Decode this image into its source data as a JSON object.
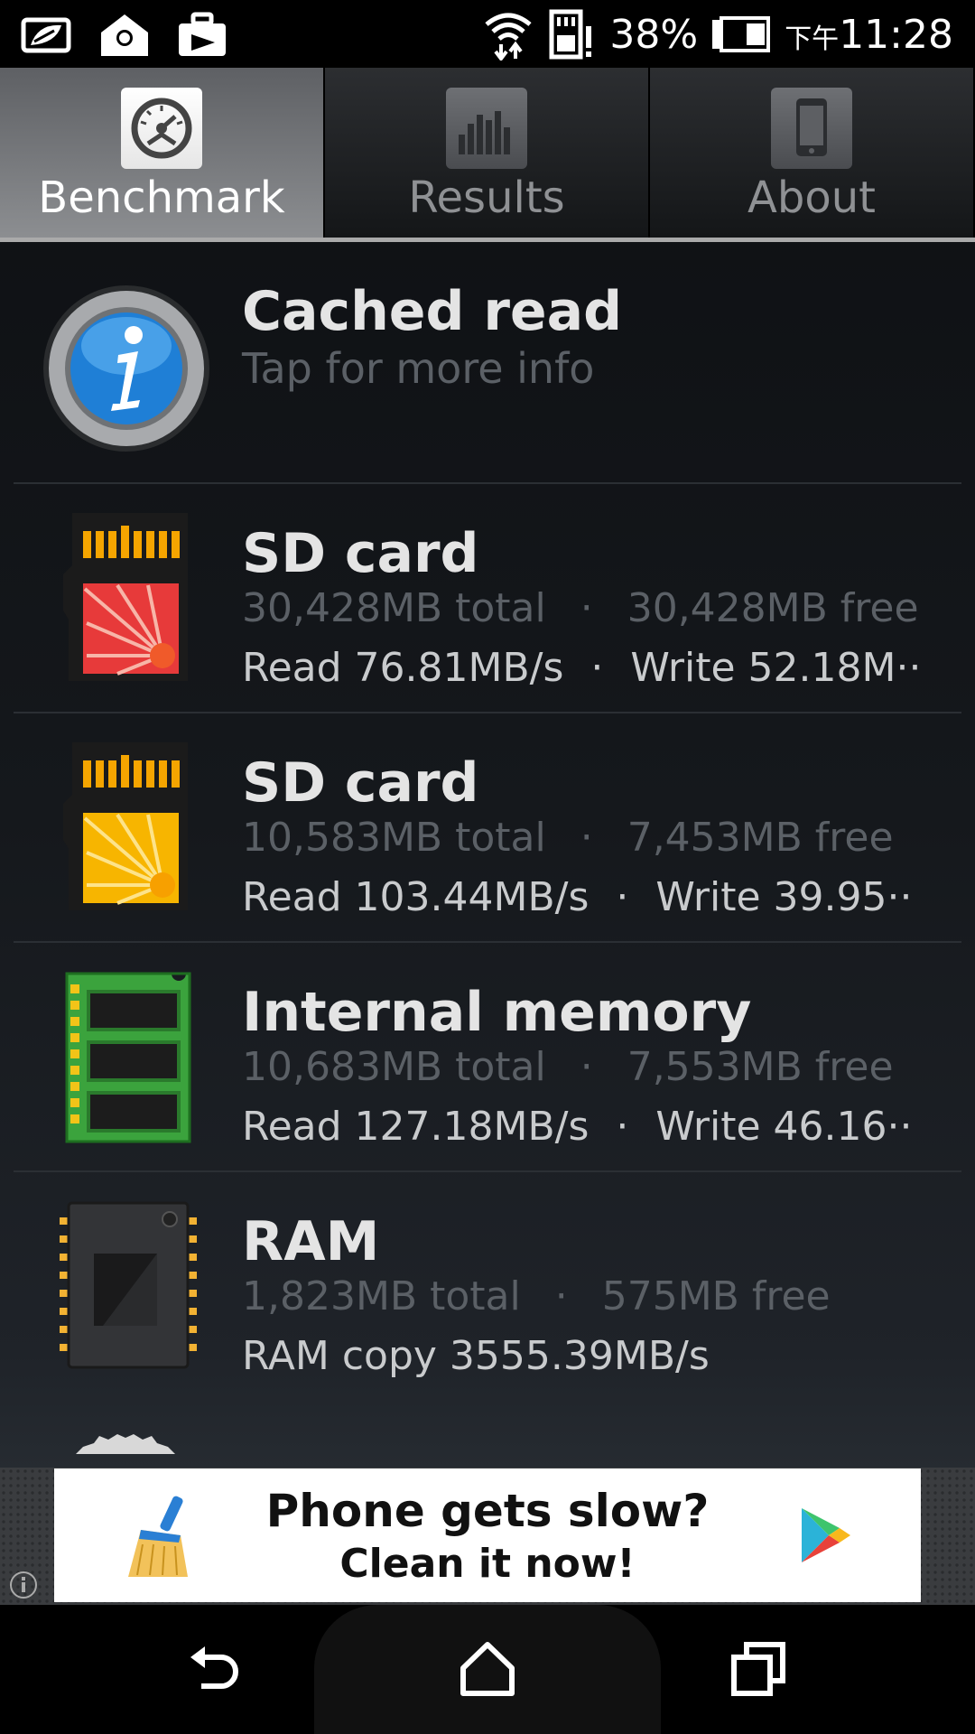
{
  "status_bar": {
    "battery_percent": "38%",
    "time_prefix": "下午",
    "time": "11:28",
    "left_icons": [
      "leaf-icon",
      "location-icon",
      "briefcase-icon"
    ],
    "right_icons": [
      "wifi-icon",
      "sd-alert-icon",
      "battery-icon"
    ]
  },
  "tabs": [
    {
      "label": "Benchmark",
      "icon": "gauge-icon",
      "active": true
    },
    {
      "label": "Results",
      "icon": "bars-icon",
      "active": false
    },
    {
      "label": "About",
      "icon": "phone-icon",
      "active": false
    }
  ],
  "list": {
    "info_row": {
      "title": "Cached read",
      "subtitle": "Tap for more info",
      "icon": "info-icon"
    },
    "items": [
      {
        "title": "SD card",
        "total": "30,428MB total",
        "free": "30,428MB free",
        "read": "Read 76.81MB/s",
        "write": "Write 52.18M··",
        "icon": "sd-card-red-icon",
        "accent": "#e53b3b"
      },
      {
        "title": "SD card",
        "total": "10,583MB total",
        "free": "7,453MB free",
        "read": "Read 103.44MB/s",
        "write": "Write 39.95··",
        "icon": "sd-card-yellow-icon",
        "accent": "#f5b800"
      },
      {
        "title": "Internal memory",
        "total": "10,683MB total",
        "free": "7,553MB free",
        "read": "Read 127.18MB/s",
        "write": "Write 46.16··",
        "icon": "memory-chip-icon",
        "accent": "#3fa341"
      },
      {
        "title": "RAM",
        "total": "1,823MB total",
        "free": "575MB free",
        "read": "RAM copy 3555.39MB/s",
        "write": "",
        "icon": "ram-chip-icon",
        "accent": "#f2b233"
      }
    ],
    "separator": "·"
  },
  "ad": {
    "line1": "Phone gets slow?",
    "line2": "Clean it now!",
    "icons": [
      "broom-icon",
      "play-store-icon",
      "ad-info-icon"
    ]
  },
  "nav": {
    "icons": [
      "back-icon",
      "home-icon",
      "recents-icon"
    ]
  }
}
